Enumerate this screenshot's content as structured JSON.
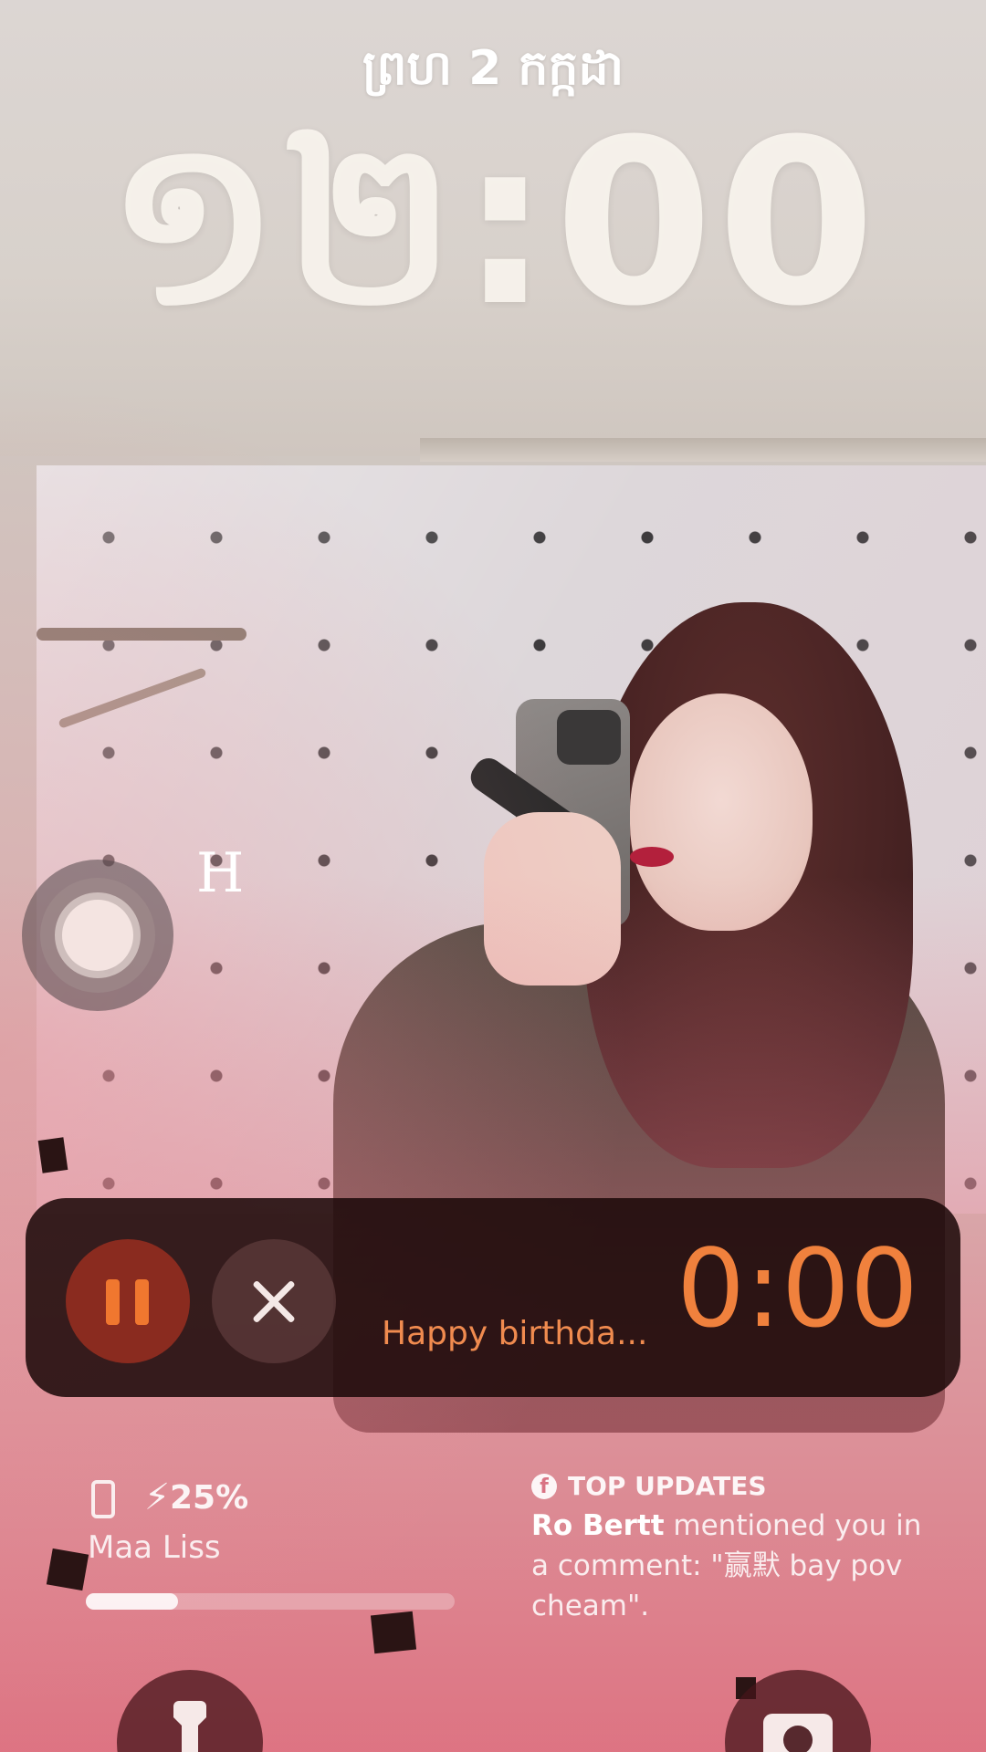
{
  "lock_screen": {
    "date": "ព្រហ 2 កក្កដា",
    "time": "១២:00"
  },
  "assistive_touch": {
    "icon": "assistive-touch-icon",
    "overlay_glyph": "H"
  },
  "live_activity": {
    "pause_icon": "pause-icon",
    "close_icon": "close-icon",
    "label": "Happy birthda...",
    "timer": "0:00",
    "accent_color": "#f0813d"
  },
  "battery_widget": {
    "icon": "phone-battery-icon",
    "charging_icon": "⚡",
    "percent": "25%",
    "level": 0.25,
    "device_name": "Maa Liss"
  },
  "notification": {
    "app_icon": "facebook-icon",
    "header": "TOP UPDATES",
    "sender": "Ro Bertt",
    "message": " mentioned you in a comment: \"赢默 bay pov cheam\"."
  },
  "bottom_controls": {
    "left": "flashlight-icon",
    "right": "camera-icon"
  }
}
